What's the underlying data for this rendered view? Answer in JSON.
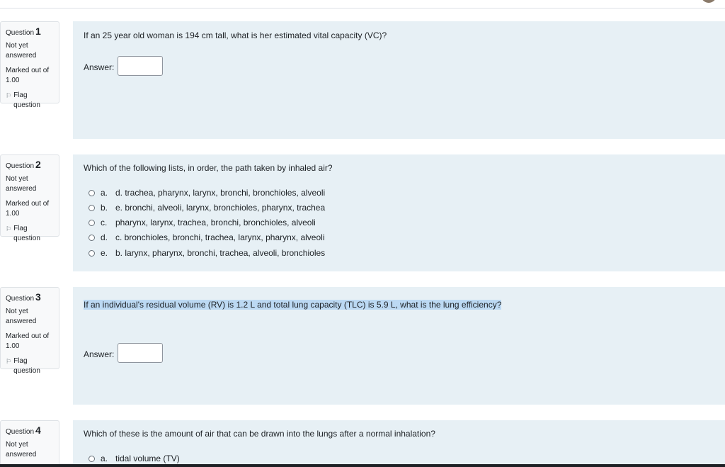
{
  "questions": [
    {
      "number": "1",
      "label": "Question",
      "status": [
        "Not yet",
        "answered"
      ],
      "marked": [
        "Marked out of",
        "1.00"
      ],
      "flag": [
        "Flag",
        "question"
      ],
      "text": "If an 25 year old woman is 194 cm tall, what is her estimated vital capacity (VC)?",
      "answer_label": "Answer:",
      "answer_value": ""
    },
    {
      "number": "2",
      "label": "Question",
      "status": [
        "Not yet",
        "answered"
      ],
      "marked": [
        "Marked out of",
        "1.00"
      ],
      "flag": [
        "Flag",
        "question"
      ],
      "text": "Which of the following lists, in order, the path taken by inhaled air?",
      "options": [
        {
          "letter": "a.",
          "text": "d. trachea, pharynx, larynx, bronchi, bronchioles, alveoli"
        },
        {
          "letter": "b.",
          "text": "e. bronchi, alveoli, larynx, bronchioles, pharynx, trachea"
        },
        {
          "letter": "c.",
          "text": "pharynx, larynx, trachea, bronchi, bronchioles, alveoli"
        },
        {
          "letter": "d.",
          "text": "c. bronchioles, bronchi, trachea, larynx, pharynx, alveoli"
        },
        {
          "letter": "e.",
          "text": "b. larynx, pharynx, bronchi, trachea, alveoli, bronchioles"
        }
      ]
    },
    {
      "number": "3",
      "label": "Question",
      "status": [
        "Not yet",
        "answered"
      ],
      "marked": [
        "Marked out of",
        "1.00"
      ],
      "flag": [
        "Flag",
        "question"
      ],
      "text": "If an individual's residual volume (RV) is 1.2 L and total lung capacity (TLC) is 5.9 L, what is the lung efficiency?",
      "answer_label": "Answer:",
      "answer_value": ""
    },
    {
      "number": "4",
      "label": "Question",
      "status": [
        "Not yet",
        "answered"
      ],
      "text": "Which of these is the amount of air that can be drawn into the lungs after a normal inhalation?",
      "options": [
        {
          "letter": "a.",
          "text": "tidal volume (TV)"
        }
      ]
    }
  ],
  "icons": {
    "flag": "flag-icon",
    "radio": "radio-icon"
  }
}
